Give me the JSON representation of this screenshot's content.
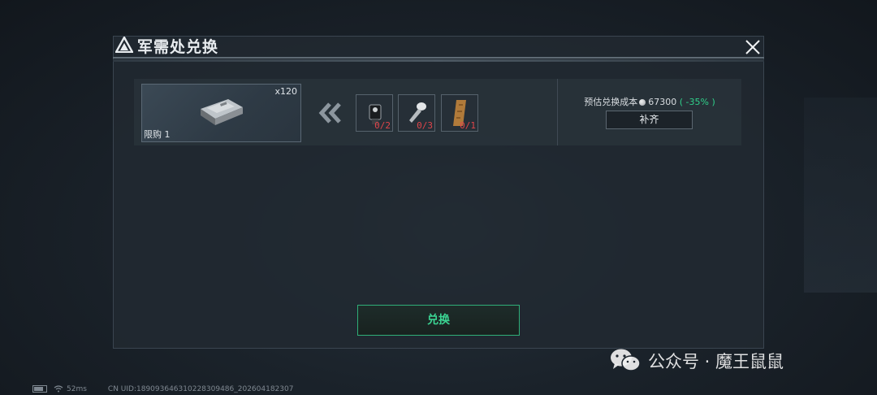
{
  "dialog": {
    "title": "军需处兑换",
    "close_icon": "close-icon",
    "logo_icon": "triangle-logo-icon"
  },
  "product": {
    "quantity": "x120",
    "limit": "限购 1",
    "icon": "ammo-box-icon"
  },
  "arrow_icon": "double-chevron-left-icon",
  "materials": [
    {
      "icon": "scope-device-icon",
      "count": "0/2"
    },
    {
      "icon": "bolt-screw-icon",
      "count": "0/3"
    },
    {
      "icon": "wooden-plank-icon",
      "count": "0/1"
    }
  ],
  "cost": {
    "label": "预估兑换成本",
    "amount": "67300",
    "discount": "( -35% )",
    "coin_icon": "coin-icon"
  },
  "buttons": {
    "fill": "补齐",
    "exchange": "兑换"
  },
  "status_bar": {
    "ping": "52ms",
    "uid": "CN UID:18909364631022830948​6_202604182307"
  },
  "watermark": {
    "text": "公众号 · 魔王鼠鼠"
  },
  "colors": {
    "accent_green": "#3bd493",
    "warning_red": "#e0454a",
    "panel_bg": "#212931"
  }
}
